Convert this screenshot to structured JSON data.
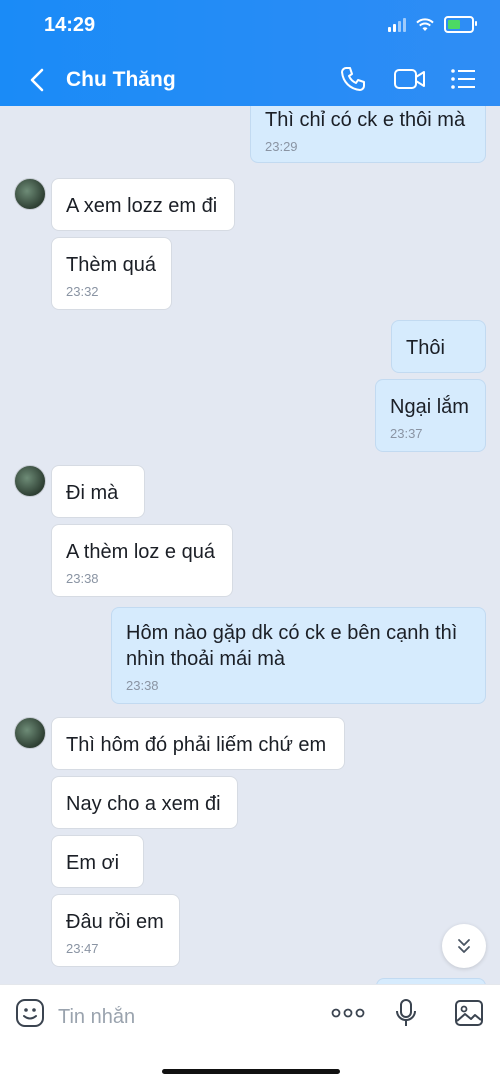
{
  "status_bar": {
    "time": "14:29"
  },
  "header": {
    "title": "Chu Thăng"
  },
  "messages": [
    {
      "dir": "out",
      "text": "Thì chỉ có ck e thôi mà",
      "time": "23:29"
    },
    {
      "dir": "in",
      "text": "A xem lozz em đi",
      "time": ""
    },
    {
      "dir": "in",
      "text": "Thèm quá",
      "time": "23:32"
    },
    {
      "dir": "out",
      "text": "Thôi",
      "time": ""
    },
    {
      "dir": "out",
      "text": "Ngại lắm",
      "time": "23:37"
    },
    {
      "dir": "in",
      "text": "Đi mà",
      "time": ""
    },
    {
      "dir": "in",
      "text": "A thèm loz e quá",
      "time": "23:38"
    },
    {
      "dir": "out",
      "text": "Hôm nào gặp dk có ck e bên cạnh thì nhìn thoải mái mà",
      "time": "23:38"
    },
    {
      "dir": "in",
      "text": "Thì hôm đó phải liếm chứ em",
      "time": ""
    },
    {
      "dir": "in",
      "text": "Nay cho a xem đi",
      "time": ""
    },
    {
      "dir": "in",
      "text": "Em ơi",
      "time": ""
    },
    {
      "dir": "in",
      "text": "Đâu rồi em",
      "time": "23:47"
    }
  ],
  "composer": {
    "placeholder": "Tin nhắn"
  },
  "icons": {
    "back": "back-arrow-icon",
    "call": "phone-icon",
    "video": "video-camera-icon",
    "menu": "list-menu-icon",
    "sticker": "sticker-icon",
    "more": "more-dots-icon",
    "mic": "microphone-icon",
    "image": "image-icon",
    "scroll": "chevron-down-double-icon"
  },
  "colors": {
    "header": "#1a8bf7",
    "outgoing_bubble": "#d6ebfd",
    "incoming_bubble": "#ffffff",
    "background": "#e3e8f2"
  }
}
